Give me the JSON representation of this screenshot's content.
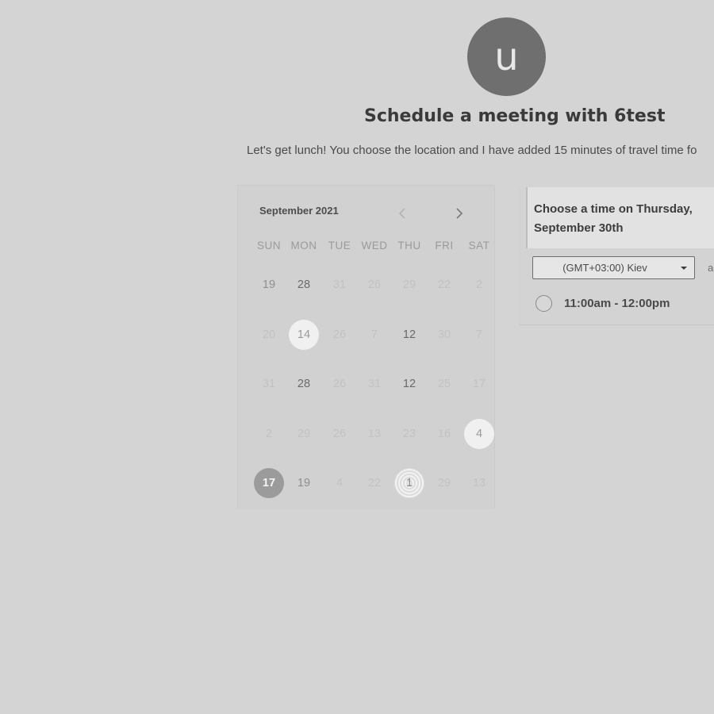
{
  "header": {
    "avatar_letter": "u",
    "title": "Schedule a meeting with 6test",
    "subtitle": "Let's get lunch! You choose the location and I have added 15 minutes of travel time fo"
  },
  "calendar": {
    "month_label": "September 2021",
    "prev_icon": "chevron-left-icon",
    "next_icon": "chevron-right-icon",
    "weekdays": [
      "SUN",
      "MON",
      "TUE",
      "WED",
      "THU",
      "FRI",
      "SAT"
    ],
    "weeks": [
      [
        {
          "d": "19",
          "s": "med"
        },
        {
          "d": "28",
          "s": "dark"
        },
        {
          "d": "31",
          "s": "faded"
        },
        {
          "d": "26",
          "s": "faded"
        },
        {
          "d": "29",
          "s": "faded"
        },
        {
          "d": "22",
          "s": "faded"
        },
        {
          "d": "2",
          "s": "faded"
        }
      ],
      [
        {
          "d": "20",
          "s": "faded"
        },
        {
          "d": "14",
          "s": "avail"
        },
        {
          "d": "26",
          "s": "faded"
        },
        {
          "d": "7",
          "s": "faded"
        },
        {
          "d": "12",
          "s": "dark"
        },
        {
          "d": "30",
          "s": "faded"
        },
        {
          "d": "7",
          "s": "faded"
        }
      ],
      [
        {
          "d": "31",
          "s": "faded"
        },
        {
          "d": "28",
          "s": "dark"
        },
        {
          "d": "26",
          "s": "faded"
        },
        {
          "d": "31",
          "s": "faded"
        },
        {
          "d": "12",
          "s": "dark"
        },
        {
          "d": "25",
          "s": "faded"
        },
        {
          "d": "17",
          "s": "faded"
        }
      ],
      [
        {
          "d": "2",
          "s": "faded"
        },
        {
          "d": "29",
          "s": "faded"
        },
        {
          "d": "26",
          "s": "faded"
        },
        {
          "d": "13",
          "s": "faded"
        },
        {
          "d": "23",
          "s": "faded"
        },
        {
          "d": "16",
          "s": "faded"
        },
        {
          "d": "4",
          "s": "avail"
        }
      ],
      [
        {
          "d": "17",
          "s": "selected"
        },
        {
          "d": "19",
          "s": "med"
        },
        {
          "d": "4",
          "s": "faded"
        },
        {
          "d": "22",
          "s": "faded"
        },
        {
          "d": "1",
          "s": "hatched"
        },
        {
          "d": "29",
          "s": "faded"
        },
        {
          "d": "13",
          "s": "faded"
        }
      ]
    ]
  },
  "time_panel": {
    "heading": "Choose a time on Thursday, September 30th",
    "timezone": "(GMT+03:00) Kiev",
    "timezone_caret_icon": "caret-down-icon",
    "side_text": "ad",
    "slots": [
      {
        "label": "11:00am - 12:00pm"
      }
    ]
  }
}
